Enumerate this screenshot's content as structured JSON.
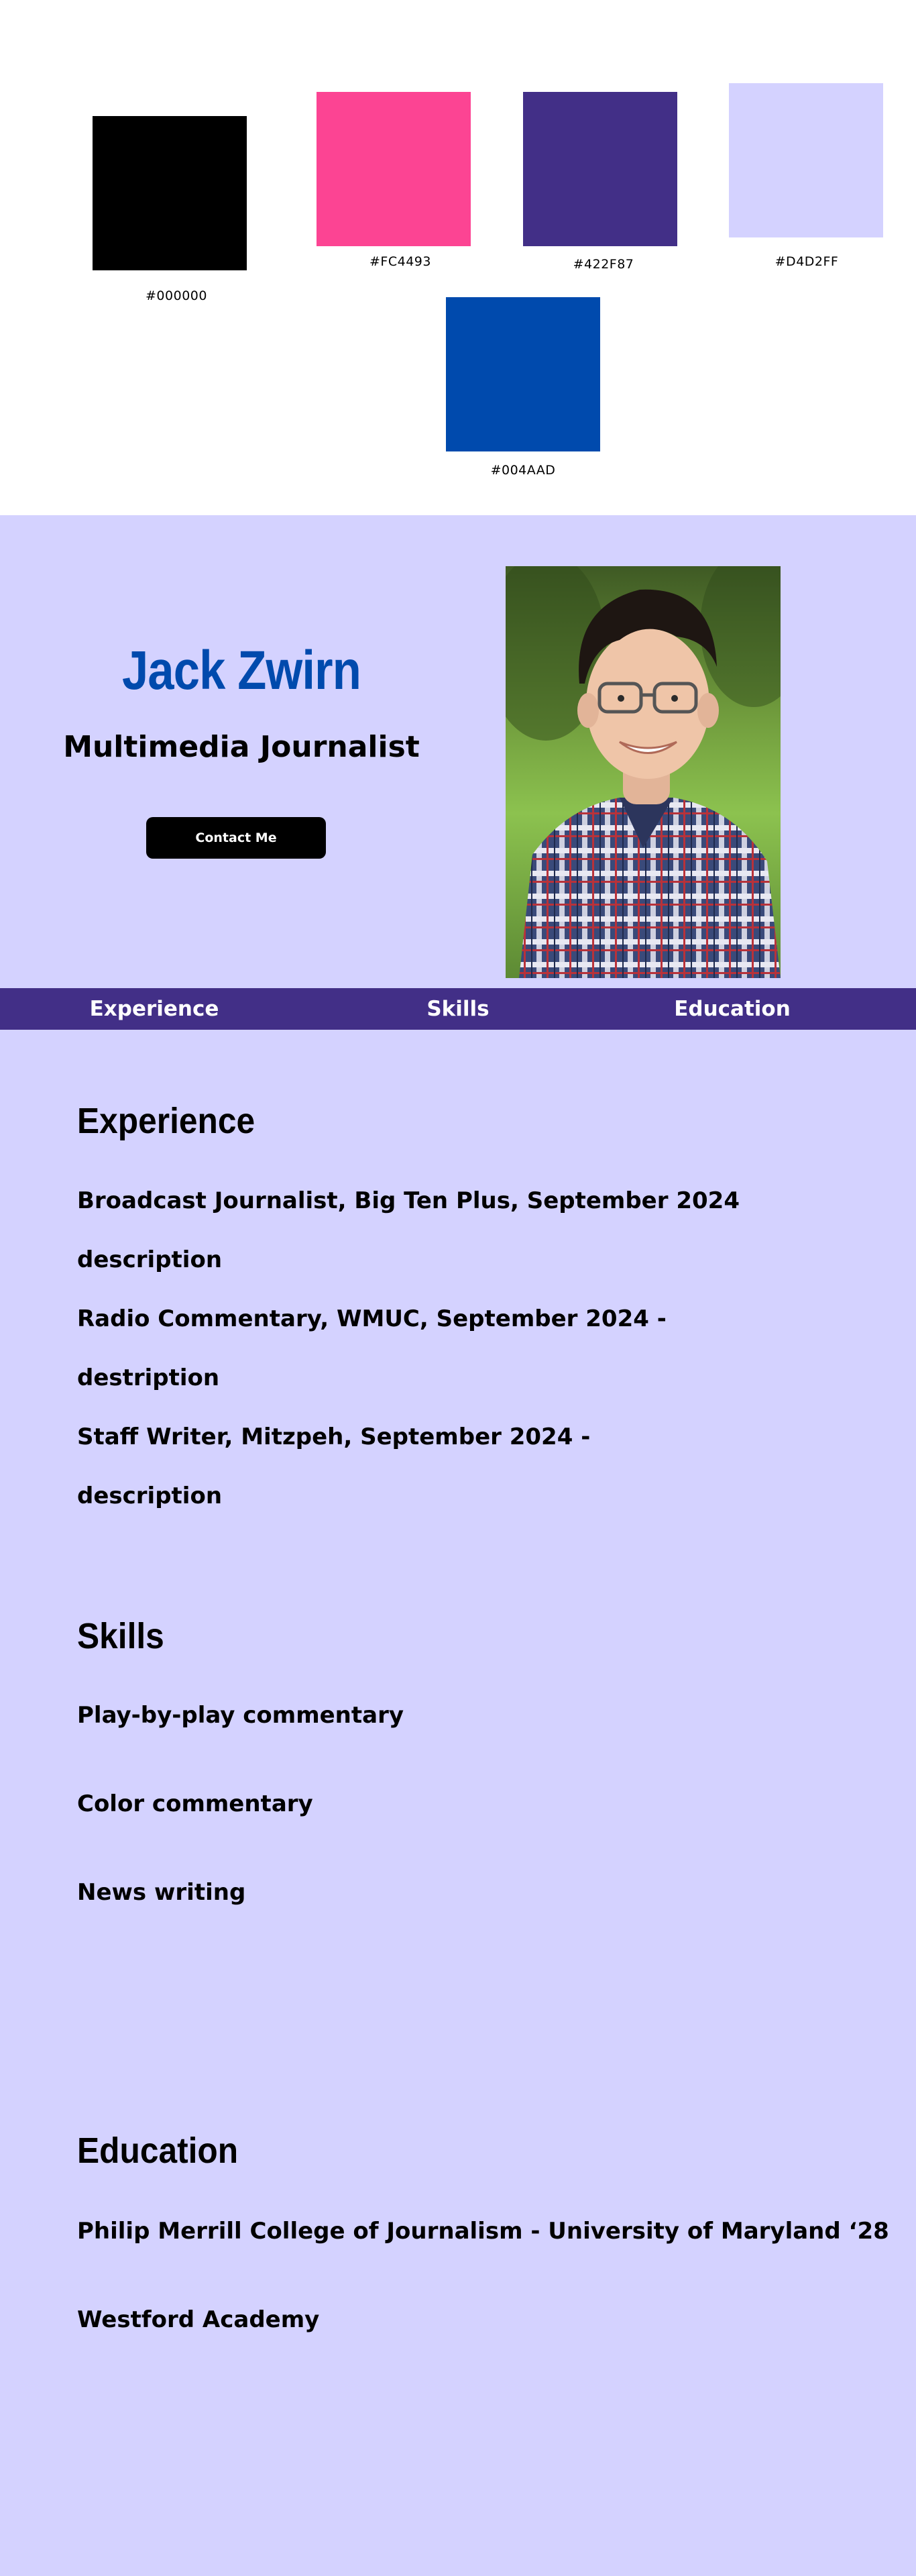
{
  "palette": {
    "swatches": [
      {
        "hex": "#000000",
        "label": "#000000"
      },
      {
        "hex": "#FC4493",
        "label": "#FC4493"
      },
      {
        "hex": "#422F87",
        "label": "#422F87"
      },
      {
        "hex": "#D4D2FF",
        "label": "#D4D2FF"
      },
      {
        "hex": "#004AAD",
        "label": "#004AAD"
      }
    ]
  },
  "hero": {
    "name": "Jack Zwirn",
    "title": "Multimedia Journalist",
    "contact_label": "Contact Me"
  },
  "nav": {
    "items": [
      "Experience",
      "Skills",
      "Education"
    ]
  },
  "experience": {
    "heading": "Experience",
    "lines": [
      "Broadcast Journalist, Big Ten Plus, September 2024",
      "description",
      "Radio Commentary, WMUC, September 2024 -",
      "destription",
      "Staff Writer, Mitzpeh, September 2024 -",
      "description"
    ]
  },
  "skills": {
    "heading": "Skills",
    "items": [
      "Play-by-play commentary",
      "Color commentary",
      "News writing"
    ]
  },
  "education": {
    "heading": "Education",
    "items": [
      "Philip Merrill College of Journalism - University of Maryland ‘28",
      "Westford Academy"
    ]
  },
  "colors": {
    "accent_blue": "#004AAD",
    "nav_purple": "#422F87",
    "background_lavender": "#D4D2FF",
    "pink": "#FC4493"
  }
}
